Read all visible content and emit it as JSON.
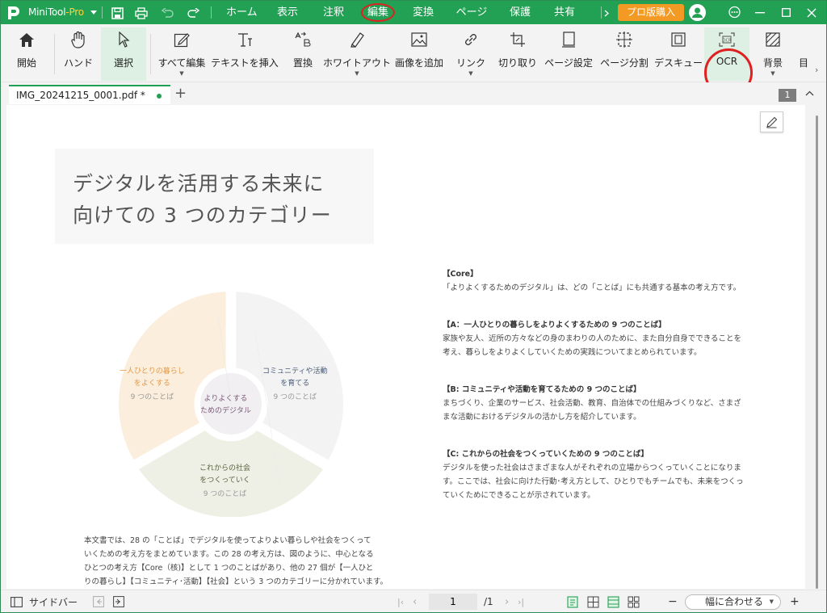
{
  "titlebar": {
    "app_name": "MiniTool",
    "app_suffix": "-Pro",
    "menus": [
      "ホーム",
      "表示",
      "注釈",
      "編集",
      "変換",
      "ページ",
      "保護",
      "共有"
    ],
    "buy_label": "プロ版購入"
  },
  "ribbon": {
    "items": [
      {
        "label": "開始",
        "icon": "home-icon"
      },
      {
        "label": "ハンド",
        "icon": "hand-icon"
      },
      {
        "label": "選択",
        "icon": "cursor-icon"
      },
      {
        "label": "すべて編集",
        "icon": "edit-all-icon"
      },
      {
        "label": "テキストを挿入",
        "icon": "insert-text-icon"
      },
      {
        "label": "置換",
        "icon": "replace-icon"
      },
      {
        "label": "ホワイトアウト",
        "icon": "whiteout-icon"
      },
      {
        "label": "画像を追加",
        "icon": "add-image-icon"
      },
      {
        "label": "リンク",
        "icon": "link-icon"
      },
      {
        "label": "切り取り",
        "icon": "crop-icon"
      },
      {
        "label": "ページ設定",
        "icon": "page-setup-icon"
      },
      {
        "label": "ページ分割",
        "icon": "split-page-icon"
      },
      {
        "label": "デスキュー",
        "icon": "deskew-icon"
      },
      {
        "label": "OCR",
        "icon": "ocr-icon"
      },
      {
        "label": "背景",
        "icon": "background-icon"
      },
      {
        "label": "目",
        "icon": "more-icon"
      }
    ]
  },
  "tabs": {
    "document_name": "IMG_20241215_0001.pdf *",
    "add_label": "+",
    "page_badge": "1"
  },
  "document": {
    "title_lines": [
      "デジタルを活用する未来に",
      "向けての 3 つのカテゴリー"
    ],
    "chart_labels": {
      "left": [
        "一人ひとりの暮らし",
        "をよくする",
        "9 つのことば"
      ],
      "right": [
        "コミュニティや活動",
        "を育てる",
        "9 つのことば"
      ],
      "bottom": [
        "これからの社会",
        "をつくっていく",
        "9 つのことば"
      ],
      "center": [
        "よりよくする",
        "ためのデジタル"
      ]
    },
    "sections": [
      {
        "heading": "【Core】",
        "lines": [
          "「よりよくするためのデジタル」は、どの「ことば」にも共通する基本の考え方です。"
        ]
      },
      {
        "heading": "【A：一人ひとりの暮らしをよりよくするための 9 つのことば】",
        "lines": [
          "家族や友人、近所の方々などの身のまわりの人のために、また自分自身でできることを",
          "考え、暮らしをよりよくしていくための実践についてまとめられています。"
        ]
      },
      {
        "heading": "【B: コミュニティや活動を育てるための 9 つのことば】",
        "lines": [
          "まちづくり、企業のサービス、社会活動、教育、自治体での仕組みづくりなど、さまざ",
          "まな活動におけるデジタルの活かし方を紹介しています。"
        ]
      },
      {
        "heading": "【C: これからの社会をつくっていくための 9 つのことば】",
        "lines": [
          "デジタルを使った社会はさまざまな人がそれぞれの立場からつくっていくことになりま",
          "す。ここでは、社会に向けた行動･考え方として、ひとりでもチームでも、未来をつくっ",
          "ていくためにできることが示されています。"
        ]
      }
    ],
    "body_lines": [
      "本文書では、28 の「ことば」でデジタルを使ってよりよい暮らしや社会をつくって",
      "いくための考え方をまとめています。この 28 の考え方は、図のように、中心となる",
      "ひとつの考え方【Core（核)】として 1 つのことばがあり、他の 27 個が【一人ひと",
      "りの暮らし】【コミュニティ･活動】【社会】という 3 つのカテゴリーに分かれています。"
    ]
  },
  "statusbar": {
    "sidebar_label": "サイドバー",
    "current_page": "1",
    "total_pages": "/1",
    "zoom_label": "幅に合わせる",
    "minus": "−",
    "plus": "+"
  },
  "colors": {
    "accent": "#22a054",
    "buy": "#f39a24",
    "annotation_ring": "#e02020",
    "segment_a": "#fbeedd",
    "segment_b": "#f3f3f3",
    "segment_c": "#eef0e6"
  }
}
